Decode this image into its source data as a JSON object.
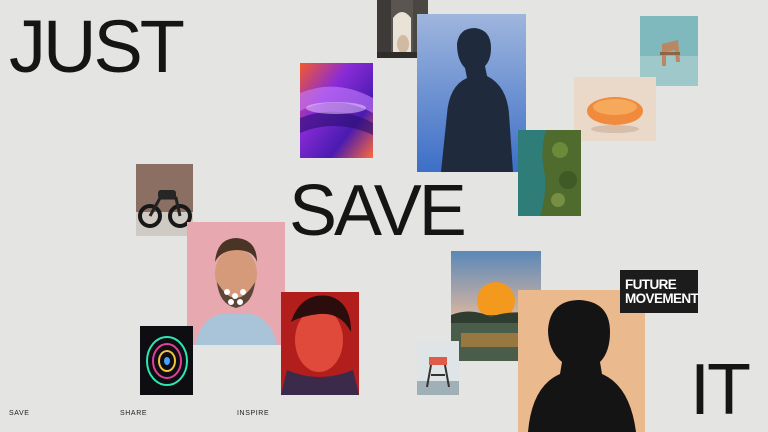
{
  "headline": {
    "word1": "JUST",
    "word2": "SAVE",
    "word3": "IT"
  },
  "nav": [
    {
      "label": "SAVE"
    },
    {
      "label": "SHARE"
    },
    {
      "label": "INSPIRE"
    }
  ],
  "badge": {
    "line1": "FUTURE",
    "line2": "MOVEMENT"
  },
  "colors": {
    "background": "#e4e4e2",
    "text": "#151515",
    "badge_bg": "#1c1c1c"
  },
  "images": [
    "doorway-photo",
    "abstract-purple-waves",
    "woman-silhouette-portrait",
    "chair-in-water",
    "orange-sculpture",
    "aerial-coastline",
    "motorcycle",
    "bearded-man-with-flowers",
    "red-portrait",
    "neon-swirl",
    "sunset-lake",
    "man-silhouette-orange",
    "lifeguard-tower"
  ]
}
